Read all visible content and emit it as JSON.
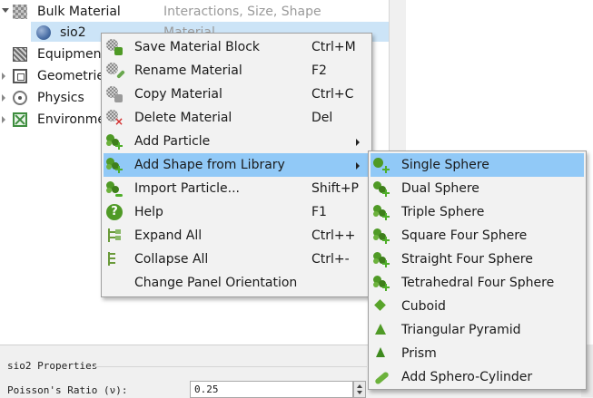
{
  "tree": {
    "rows": [
      {
        "label": "Bulk Material",
        "desc": "Interactions, Size, Shape"
      },
      {
        "label": "sio2",
        "desc": "Material"
      },
      {
        "label": "Equipment"
      },
      {
        "label": "Geometries"
      },
      {
        "label": "Physics"
      },
      {
        "label": "Environment"
      }
    ]
  },
  "context_menu": {
    "items": [
      {
        "label": "Save Material Block",
        "shortcut": "Ctrl+M",
        "icon": "save-material-icon"
      },
      {
        "label": "Rename Material",
        "shortcut": "F2",
        "icon": "rename-material-icon"
      },
      {
        "label": "Copy Material",
        "shortcut": "Ctrl+C",
        "icon": "copy-material-icon"
      },
      {
        "label": "Delete Material",
        "shortcut": "Del",
        "icon": "delete-material-icon"
      },
      {
        "label": "Add Particle",
        "shortcut": "",
        "icon": "add-particle-icon",
        "submenu": true
      },
      {
        "label": "Add Shape from Library",
        "shortcut": "",
        "icon": "add-shape-icon",
        "submenu": true,
        "highlighted": true
      },
      {
        "label": "Import Particle...",
        "shortcut": "Shift+P",
        "icon": "import-particle-icon"
      },
      {
        "label": "Help",
        "shortcut": "F1",
        "icon": "help-icon"
      },
      {
        "label": "Expand All",
        "shortcut": "Ctrl++",
        "icon": "expand-all-icon"
      },
      {
        "label": "Collapse All",
        "shortcut": "Ctrl+-",
        "icon": "collapse-all-icon"
      },
      {
        "label": "Change Panel Orientation",
        "shortcut": "",
        "icon": ""
      }
    ]
  },
  "shape_submenu": {
    "items": [
      {
        "label": "Single Sphere",
        "icon": "single-sphere-icon",
        "highlighted": true
      },
      {
        "label": "Dual Sphere",
        "icon": "dual-sphere-icon"
      },
      {
        "label": "Triple Sphere",
        "icon": "triple-sphere-icon"
      },
      {
        "label": "Square Four Sphere",
        "icon": "square-four-sphere-icon"
      },
      {
        "label": "Straight Four Sphere",
        "icon": "straight-four-sphere-icon"
      },
      {
        "label": "Tetrahedral Four Sphere",
        "icon": "tetrahedral-four-sphere-icon"
      },
      {
        "label": "Cuboid",
        "icon": "cuboid-icon"
      },
      {
        "label": "Triangular Pyramid",
        "icon": "triangular-pyramid-icon"
      },
      {
        "label": "Prism",
        "icon": "prism-icon"
      },
      {
        "label": "Add Sphero-Cylinder",
        "icon": "sphero-cylinder-icon"
      }
    ]
  },
  "properties": {
    "title": "sio2 Properties",
    "field_label": "Poisson's Ratio (ν):",
    "field_value": "0.25"
  },
  "colors": {
    "highlight": "#91c9f7",
    "selection": "#cce4f7",
    "menu_bg": "#f2f2f2",
    "icon_green": "#4f9a26"
  }
}
